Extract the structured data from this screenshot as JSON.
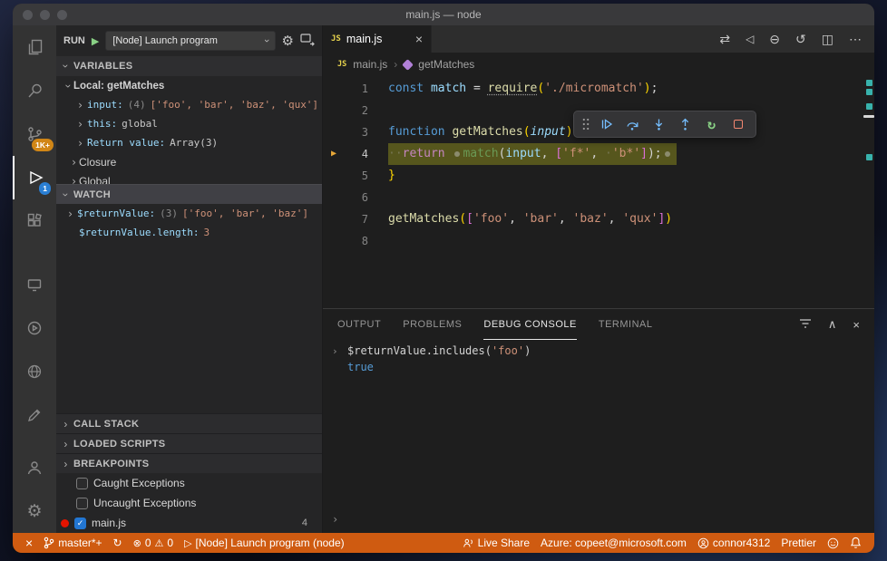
{
  "icons": {
    "chevron": "›",
    "check": "✓",
    "close": "×",
    "gear": "⚙",
    "play_solid": "▶",
    "play_outline": "▷",
    "warning": "⚠",
    "error": "⊗",
    "sync": "↻",
    "remote": "×",
    "swap": "⇄",
    "triangle_left": "◁",
    "circle_dash": "⊖",
    "circle_arrow": "↺",
    "split_editor": "◫",
    "ellipsis": "⋯",
    "chevron_up": "∧"
  },
  "window": {
    "title": "main.js — node"
  },
  "activity": {
    "scm_badge": "1K+",
    "debug_badge": "1"
  },
  "sidebar": {
    "run": {
      "label": "RUN",
      "config": "[Node] Launch program"
    },
    "variables": {
      "title": "VARIABLES",
      "scope": "Local: getMatches",
      "input": {
        "name": "input:",
        "count": "(4)",
        "value": "['foo', 'bar', 'baz', 'qux']"
      },
      "this": {
        "name": "this:",
        "value": "global"
      },
      "retval": {
        "name": "Return value:",
        "value": "Array(3)"
      },
      "closure": "Closure",
      "global": "Global"
    },
    "watch": {
      "title": "WATCH",
      "row1": {
        "name": "$returnValue:",
        "count": "(3)",
        "value": "['foo', 'bar', 'baz']"
      },
      "row2": {
        "name": "$returnValue.length:",
        "value": "3"
      }
    },
    "call_stack": "CALL STACK",
    "loaded_scripts": "LOADED SCRIPTS",
    "breakpoints": {
      "title": "BREAKPOINTS",
      "caught": "Caught Exceptions",
      "uncaught": "Uncaught Exceptions",
      "file": "main.js",
      "file_line": "4"
    }
  },
  "editor": {
    "tab": "main.js",
    "js_badge": "JS",
    "breadcrumb": {
      "file": "main.js",
      "symbol": "getMatches"
    },
    "gutter": [
      "1",
      "2",
      "3",
      "4",
      "5",
      "6",
      "7",
      "8"
    ],
    "code": {
      "l1": [
        "const ",
        "match ",
        "= ",
        "require",
        "(",
        "'./micromatch'",
        ")",
        ";"
      ],
      "l3": [
        "function ",
        "getMatches",
        "(",
        "input",
        ") ",
        "{"
      ],
      "l4": [
        "··",
        "return ",
        "match",
        "(",
        "input",
        ", ",
        "[",
        "'f*'",
        ", ",
        "·",
        "'b*'",
        "]",
        ");"
      ],
      "l5": [
        "}"
      ],
      "l7": [
        "getMatches",
        "(",
        "[",
        "'foo'",
        ", ",
        "'bar'",
        ", ",
        "'baz'",
        ", ",
        "'qux'",
        "]",
        ")"
      ]
    }
  },
  "panel": {
    "tabs": {
      "output": "OUTPUT",
      "problems": "PROBLEMS",
      "debug": "DEBUG CONSOLE",
      "terminal": "TERMINAL"
    },
    "expr": {
      "pre": "$returnValue.includes(",
      "str": "'foo'",
      "post": ")"
    },
    "result": "true"
  },
  "status": {
    "branch": "master*+",
    "errors": "0",
    "warnings": "0",
    "launch": "[Node] Launch program (node)",
    "live_share": "Live Share",
    "azure": "Azure: copeet@microsoft.com",
    "account": "connor4312",
    "formatter": "Prettier"
  }
}
